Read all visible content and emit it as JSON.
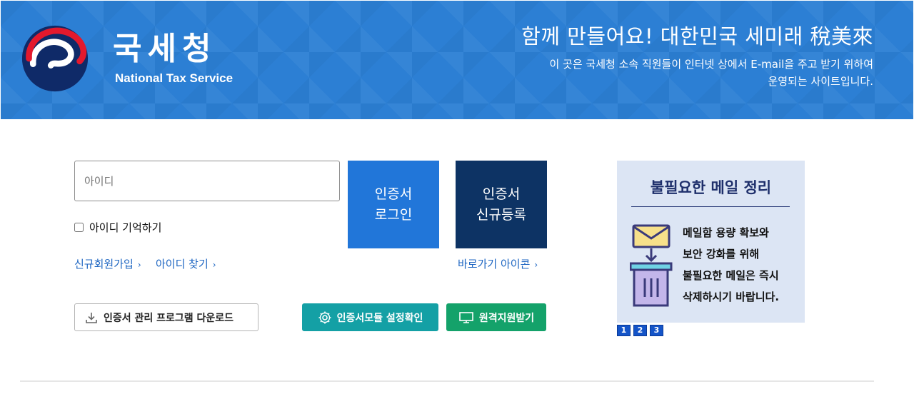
{
  "header": {
    "org_name": "국세청",
    "org_name_en": "National Tax Service",
    "slogan": "함께 만들어요! 대한민국 세미래 稅美來",
    "description_line1": "이 곳은 국세청 소속 직원들이 인터넷 상에서 E-mail을 주고 받기 위하여",
    "description_line2": "운영되는 사이트입니다.",
    "background_color": "#2c7fd4"
  },
  "login": {
    "id_placeholder": "아이디",
    "remember_label": "아이디 기억하기",
    "remember_checked": false,
    "cert_login_line1": "인증서",
    "cert_login_line2": "로그인",
    "cert_register_line1": "인증서",
    "cert_register_line2": "신규등록",
    "signup_link": "신규회원가입",
    "find_id_link": "아이디 찾기",
    "shortcut_link": "바로가기 아이콘",
    "download_button": "인증서 관리 프로그램 다운로드",
    "module_button": "인증서모듈 설정확인",
    "remote_button": "원격지원받기"
  },
  "notice": {
    "title": "불필요한 메일 정리",
    "line1": "메일함 용량 확보와",
    "line2": "보안 강화를 위해",
    "line3": "불필요한 메일은 즉시",
    "line4": "삭제하시기 바랍니다.",
    "pages": [
      "1",
      "2",
      "3"
    ]
  },
  "colors": {
    "cert_login_bg": "#2176d9",
    "cert_register_bg": "#0d3364",
    "module_bg": "#14a0a5",
    "remote_bg": "#14a26a",
    "link": "#1e66c2"
  }
}
